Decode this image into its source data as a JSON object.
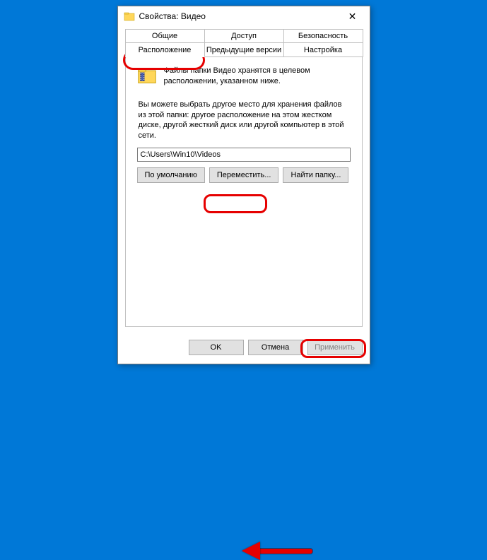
{
  "window": {
    "title": "Свойства: Видео"
  },
  "tabs": {
    "row1": [
      "Общие",
      "Доступ",
      "Безопасность"
    ],
    "row2": [
      "Расположение",
      "Предыдущие версии",
      "Настройка"
    ],
    "active": "Расположение"
  },
  "content": {
    "info": "Файлы папки Видео хранятся в целевом расположении, указанном ниже.",
    "description": "Вы можете выбрать другое место для хранения файлов из этой папки: другое расположение на этом жестком диске, другой жесткий диск или другой компьютер в этой сети.",
    "path": "C:\\Users\\Win10\\Videos",
    "buttons": {
      "default": "По умолчанию",
      "move": "Переместить...",
      "find": "Найти папку..."
    }
  },
  "footer": {
    "ok": "OK",
    "cancel": "Отмена",
    "apply": "Применить"
  }
}
